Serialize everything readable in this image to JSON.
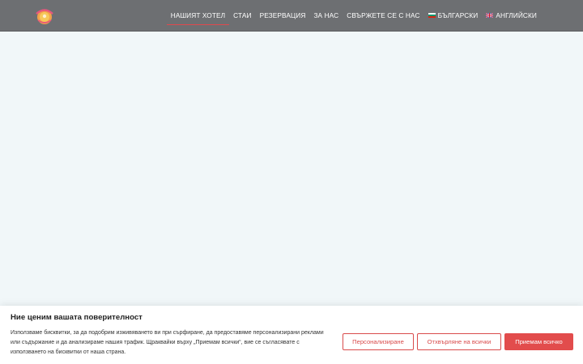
{
  "header": {
    "nav": [
      {
        "label": "НАШИЯТ ХОТЕЛ",
        "active": true
      },
      {
        "label": "СТАИ"
      },
      {
        "label": "РЕЗЕРВАЦИЯ"
      },
      {
        "label": "ЗА НАС"
      },
      {
        "label": "СВЪРЖЕТЕ СЕ С НАС"
      },
      {
        "label": "БЪЛГАРСКИ",
        "icon": "bulgaria-flag-icon"
      },
      {
        "label": "АНГЛИЙСКИ",
        "icon": "uk-flag-icon"
      }
    ],
    "logo_icon": "hotel-logo-icon"
  },
  "consent": {
    "title": "Ние ценим вашата поверителност",
    "text": "Използваме бисквитки, за да подобрим изживяването ви при сърфиране, да предоставяме персонализирани реклами или съдържание и да анализираме нашия трафик. Щраквайки върху „Приемам всички“, вие се съгласявате с използването на бисквитки от наша страна.",
    "customize_label": "Персонализиране",
    "reject_label": "Отхвърляне на всички",
    "accept_label": "Приемам всичко"
  },
  "colors": {
    "header_bg": "#6d6f72",
    "page_bg": "#f1f7f9",
    "accent": "#e24c4c"
  }
}
